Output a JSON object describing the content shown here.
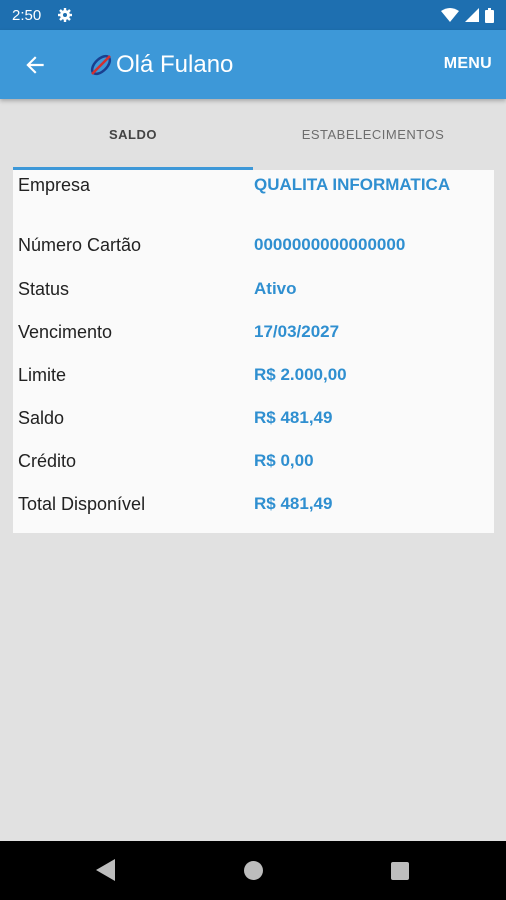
{
  "status_bar": {
    "time": "2:50",
    "icons": [
      "gear-icon",
      "wifi-icon",
      "signal-icon",
      "battery-icon"
    ]
  },
  "app_bar": {
    "title": "Olá Fulano",
    "menu_label": "MENU",
    "icons": [
      "back-arrow-icon",
      "app-logo-icon"
    ]
  },
  "tabs": [
    {
      "label": "SALDO",
      "selected": true
    },
    {
      "label": "ESTABELECIMENTOS",
      "selected": false
    }
  ],
  "details": [
    {
      "label": "Empresa",
      "value": "QUALITA INFORMATICA"
    },
    {
      "label": "Número Cartão",
      "value": "0000000000000000"
    },
    {
      "label": "Status",
      "value": "Ativo"
    },
    {
      "label": "Vencimento",
      "value": "17/03/2027"
    },
    {
      "label": "Limite",
      "value": "R$ 2.000,00"
    },
    {
      "label": "Saldo",
      "value": "R$ 481,49"
    },
    {
      "label": "Crédito",
      "value": "R$ 0,00"
    },
    {
      "label": "Total Disponível",
      "value": "R$ 481,49"
    }
  ],
  "nav_bar": {
    "icons": [
      "back-triangle-icon",
      "home-circle-icon",
      "recents-square-icon"
    ]
  },
  "colors": {
    "status_bar": "#1e6fb0",
    "app_bar": "#3d98d8",
    "accent": "#2f8fd0",
    "background": "#e1e1e1"
  }
}
